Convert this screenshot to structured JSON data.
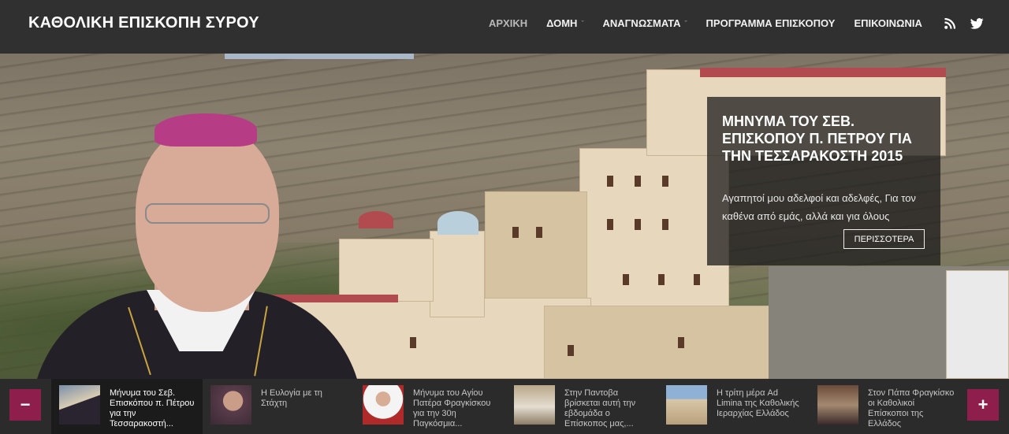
{
  "site": {
    "title": "ΚΑΘΟΛΙΚΗ ΕΠΙΣΚΟΠΗ ΣΥΡΟΥ"
  },
  "nav": {
    "items": [
      {
        "label": "ΑΡΧΙΚΗ"
      },
      {
        "label": "ΔΟΜΗ"
      },
      {
        "label": "ΑΝΑΓΝΩΣΜΑΤΑ"
      },
      {
        "label": "ΠΡΟΓΡΑΜΜΑ ΕΠΙΣΚΟΠΟΥ"
      },
      {
        "label": "ΕΠΙΚΟΙΝΩΝΙΑ"
      }
    ],
    "dropdown_glyph": "ˇ"
  },
  "social": {
    "rss_icon": "rss-icon",
    "twitter_icon": "twitter-icon"
  },
  "hero": {
    "title": "ΜΗΝΥΜΑ ΤΟΥ ΣΕΒ. ΕΠΙΣΚΟΠΟΥ Π. ΠΕΤΡΟΥ ΓΙΑ ΤΗΝ ΤΕΣΣΑΡΑΚΟΣΤΗ 2015",
    "excerpt": "Αγαπητοί μου αδελφοί και αδελφές, Για τον καθένα από εμάς, αλλά και για όλους",
    "more_label": "ΠΕΡΙΣΣΟΤΕΡΑ"
  },
  "carousel": {
    "prev_label": "−",
    "next_label": "+",
    "items": [
      {
        "title": "Μήνυμα του Σεβ. Επισκόπου π. Πέτρου για την Τεσσαρακοστή..."
      },
      {
        "title": "Η Ευλογία με τη Στάχτη"
      },
      {
        "title": "Μήνυμα του Αγίου Πατέρα Φραγκίσκου για την 30η Παγκόσμια..."
      },
      {
        "title": "Στην Παντοβα βρίσκεται αυτή την εβδομάδα ο Επίσκοπος μας,..."
      },
      {
        "title": "Η τρίτη μέρα Ad Limina της Καθολικής Ιεραρχίας Ελλάδος"
      },
      {
        "title": "Στον Πάπα Φραγκίσκο οι Καθολικοί Επίσκοποι της Ελλάδος"
      }
    ]
  },
  "colors": {
    "header_bg": "#303030",
    "accent": "#8e1f4c",
    "strip_bg": "#2b2b2b"
  }
}
